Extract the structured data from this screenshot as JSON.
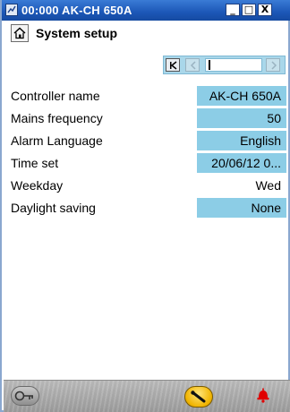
{
  "window": {
    "title": "00:000 AK-CH 650A",
    "min_glyph": "_",
    "max_glyph": "□",
    "close_glyph": "X"
  },
  "header": {
    "title": "System setup",
    "home_icon": "home-icon"
  },
  "pager": {
    "first_icon": "first-page-icon",
    "prev_icon": "prev-page-icon",
    "next_icon": "next-page-icon"
  },
  "settings": [
    {
      "label": "Controller name",
      "value": "AK-CH 650A",
      "editable": true
    },
    {
      "label": "Mains frequency",
      "value": "50",
      "editable": true
    },
    {
      "label": "Alarm Language",
      "value": "English",
      "editable": true
    },
    {
      "label": "Time set",
      "value": "20/06/12 0...",
      "editable": true
    },
    {
      "label": "Weekday",
      "value": "Wed",
      "editable": false
    },
    {
      "label": "Daylight saving",
      "value": "None",
      "editable": true
    }
  ],
  "statusbar": {
    "login_icon": "key-icon",
    "service_icon": "wrench-icon",
    "alarm_icon": "alarm-bell-icon"
  },
  "colors": {
    "field_background": "#8ccde6",
    "pager_background": "#a9d7ea",
    "titlebar": "#1c57b7",
    "alarm": "#e00000"
  }
}
